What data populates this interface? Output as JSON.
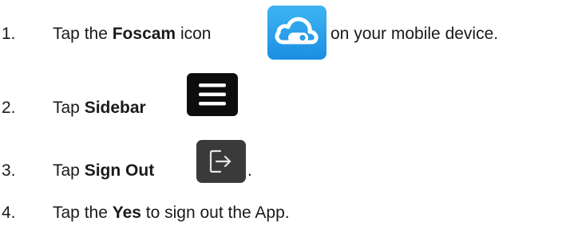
{
  "steps": [
    {
      "number": "1.",
      "prefix": "Tap the ",
      "bold": "Foscam",
      "suffix": " icon",
      "after_icon": " on your mobile device.",
      "icon": "foscam-cloud-icon",
      "icon_color": "#2a9ee8"
    },
    {
      "number": "2.",
      "prefix": "Tap ",
      "bold": "Sidebar",
      "icon": "hamburger-menu-icon",
      "icon_color": "#0d0d0d"
    },
    {
      "number": "3.",
      "prefix": "Tap ",
      "bold": "Sign Out",
      "after_icon": ".",
      "icon": "sign-out-icon",
      "icon_color": "#3a3a3a"
    },
    {
      "number": "4.",
      "prefix": "Tap the ",
      "bold": "Yes",
      "suffix": " to sign out the App."
    }
  ]
}
